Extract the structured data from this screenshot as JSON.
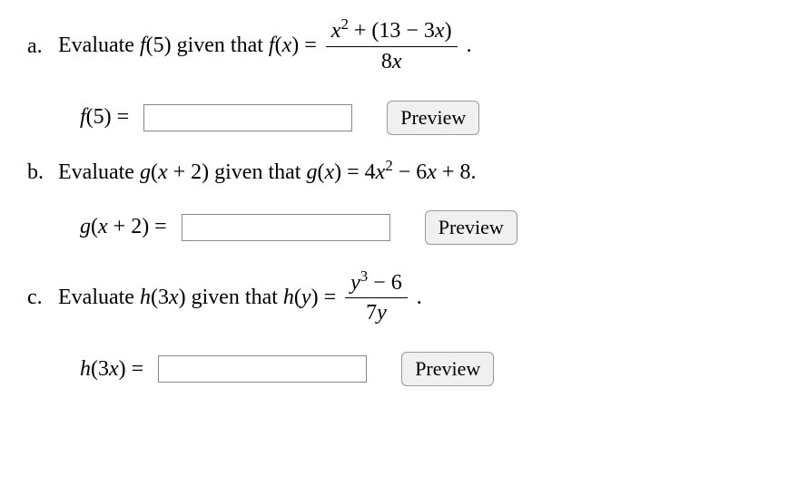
{
  "problems": [
    {
      "label": "a.",
      "prompt_prefix": "Evaluate ",
      "eval_expr": "f(5)",
      "given_text": " given that ",
      "func_lhs": "f(x)",
      "equals": " = ",
      "frac_num": "x² + (13 − 3x)",
      "frac_den": "8x",
      "trailing_dot": ".",
      "answer_lhs": "f(5) = ",
      "input_value": "",
      "preview_label": "Preview"
    },
    {
      "label": "b.",
      "prompt_prefix": "Evaluate ",
      "eval_expr": "g(x + 2)",
      "given_text": " given that ",
      "func_lhs": "g(x)",
      "equals": " = ",
      "rhs_inline": "4x² − 6x + 8.",
      "answer_lhs": "g(x + 2) = ",
      "input_value": "",
      "preview_label": "Preview"
    },
    {
      "label": "c.",
      "prompt_prefix": "Evaluate ",
      "eval_expr": "h(3x)",
      "given_text": " given that ",
      "func_lhs": "h(y)",
      "equals": " = ",
      "frac_num": "y³ − 6",
      "frac_den": "7y",
      "trailing_dot": ".",
      "answer_lhs": "h(3x) = ",
      "input_value": "",
      "preview_label": "Preview"
    }
  ]
}
